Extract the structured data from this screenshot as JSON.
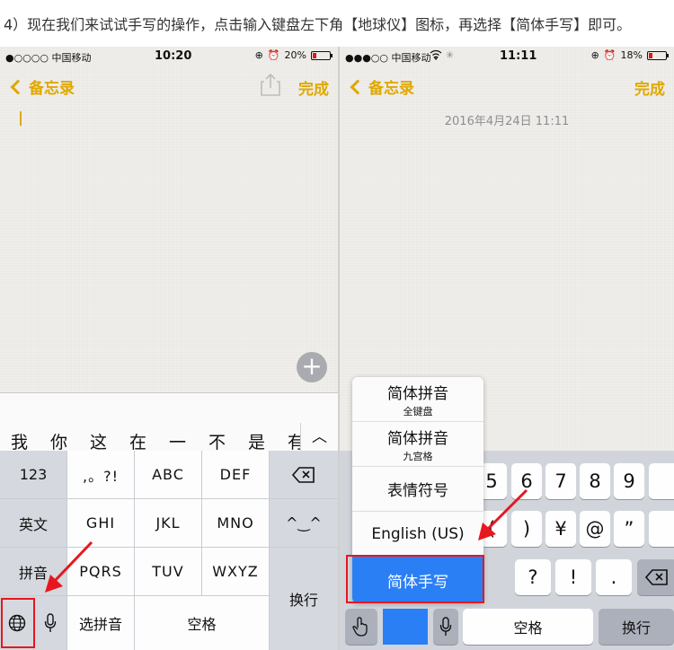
{
  "caption": "4）现在我们来试试手写的操作，点击输入键盘左下角【地球仪】图标，再选择【简体手写】即可。",
  "left_phone": {
    "status": {
      "carrier": "●○○○○ 中国移动",
      "time": "10:20",
      "battery": "20%",
      "battery_level": 0.2
    },
    "nav": {
      "back_label": "备忘录",
      "done_label": "完成"
    },
    "candidates": [
      "我",
      "你",
      "这",
      "在",
      "一",
      "不",
      "是",
      "有"
    ],
    "collapse_symbol": "︿",
    "keyboard": {
      "col1": [
        "123",
        "英文",
        "拼音"
      ],
      "row1": [
        ",。?!",
        "ABC",
        "DEF"
      ],
      "row2": [
        "GHI",
        "JKL",
        "MNO"
      ],
      "row3": [
        "PQRS",
        "TUV",
        "WXYZ"
      ],
      "emoticon": "^‿^",
      "enter": "换行",
      "pinyin_select": "选拼音",
      "space": "空格"
    }
  },
  "right_phone": {
    "status": {
      "carrier": "●●●○○ 中国移动",
      "time": "11:11",
      "battery": "18%",
      "battery_level": 0.18
    },
    "nav": {
      "back_label": "备忘录",
      "done_label": "完成"
    },
    "date": "2016年4月24日 11:11",
    "language_menu": [
      {
        "title": "简体拼音",
        "sub": "全键盘"
      },
      {
        "title": "简体拼音",
        "sub": "九宫格"
      },
      {
        "title": "表情符号",
        "sub": ""
      },
      {
        "title": "English (US)",
        "sub": ""
      },
      {
        "title": "简体手写",
        "sub": ""
      }
    ],
    "keys_row1": [
      "5",
      "6",
      "7",
      "8",
      "9"
    ],
    "keys_row2": [
      "(",
      ")",
      "¥",
      "@",
      "”"
    ],
    "keys_row3": [
      "?",
      "!",
      "."
    ],
    "space": "空格",
    "enter": "换行"
  }
}
